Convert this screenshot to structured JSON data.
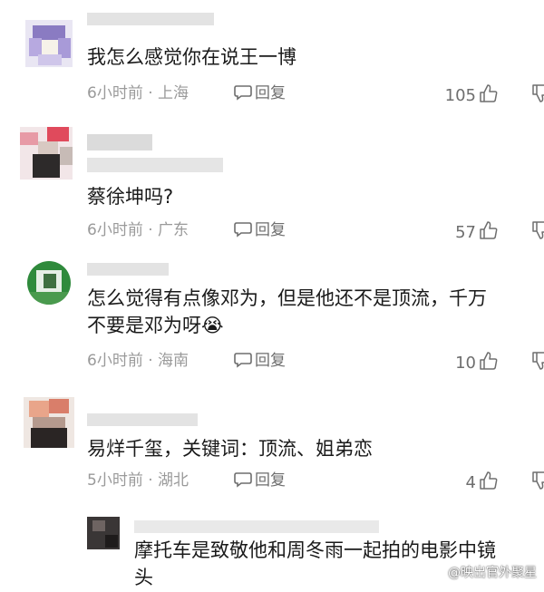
{
  "comments": [
    {
      "text_lines": [
        "我怎么感觉你在说王一博"
      ],
      "time": "6小时前",
      "location": "上海",
      "reply_label": "回复",
      "likes": "105"
    },
    {
      "text_lines": [
        "蔡徐坤吗?"
      ],
      "time": "6小时前",
      "location": "广东",
      "reply_label": "回复",
      "likes": "57"
    },
    {
      "text_lines": [
        "怎么觉得有点像邓为，但是他还不是顶流，千万",
        "不要是邓为呀😭"
      ],
      "time": "6小时前",
      "location": "海南",
      "reply_label": "回复",
      "likes": "10"
    },
    {
      "text_lines": [
        "易烊千玺，关键词：顶流、姐弟恋"
      ],
      "time": "5小时前",
      "location": "湖北",
      "reply_label": "回复",
      "likes": "4"
    }
  ],
  "sub_reply": {
    "text_lines": [
      "摩托车是致敬他和周冬雨一起拍的电影中镜",
      "头"
    ]
  },
  "meta_separator": "·",
  "watermark": "@映出官外聚星"
}
